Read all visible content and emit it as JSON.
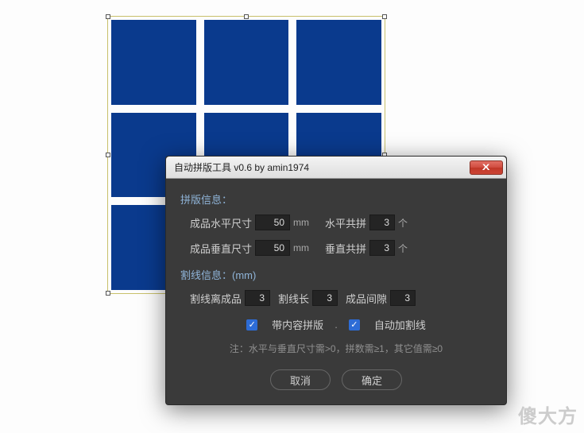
{
  "dialog": {
    "title": "自动拼版工具 v0.6   by amin1974",
    "layout_section": "拼版信息：",
    "width_label": "成品水平尺寸",
    "width_value": "50",
    "height_label": "成品垂直尺寸",
    "height_value": "50",
    "unit_mm": "mm",
    "hcount_label": "水平共拼",
    "hcount_value": "3",
    "vcount_label": "垂直共拼",
    "vcount_value": "3",
    "unit_ge": "个",
    "cut_section": "割线信息：(mm)",
    "cut_dist_label": "割线离成品",
    "cut_dist_value": "3",
    "cut_len_label": "割线长",
    "cut_len_value": "3",
    "gap_label": "成品间隙",
    "gap_value": "3",
    "cb1_label": "带内容拼版",
    "cb2_label": "自动加割线",
    "note": "注：水平与垂直尺寸需>0，拼数需≥1，其它值需≥0",
    "cancel": "取消",
    "ok": "确定"
  },
  "watermark": "傻大方"
}
